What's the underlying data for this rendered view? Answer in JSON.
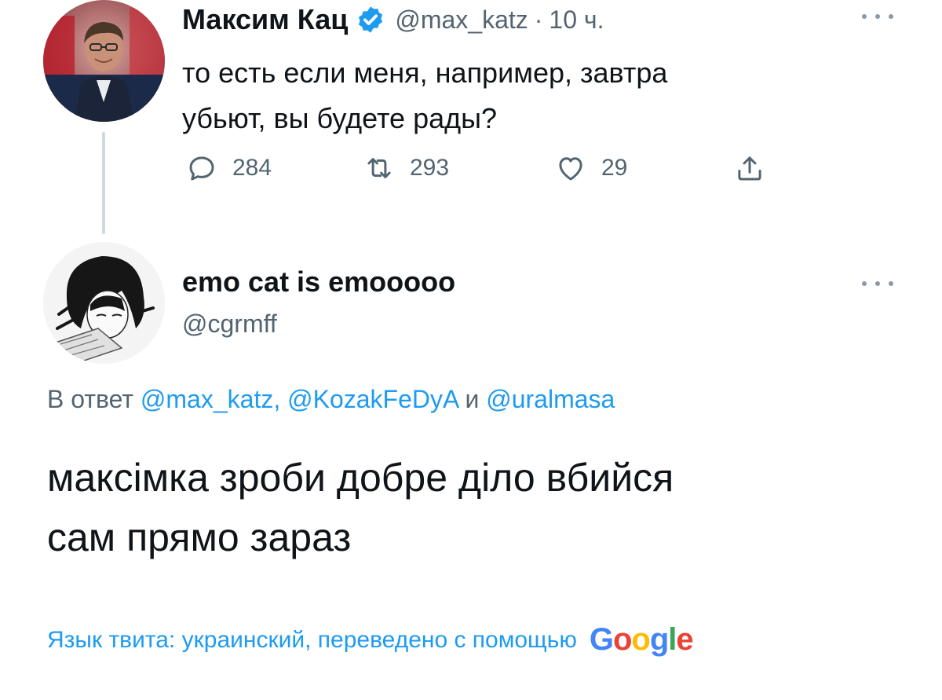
{
  "parent_tweet": {
    "author_name": "Максим Кац",
    "handle": "@max_katz",
    "separator": "·",
    "time": "10 ч.",
    "text_line1": "то есть если меня, например, завтра",
    "text_line2": "убьют, вы будете рады?",
    "stats": {
      "replies": "284",
      "retweets": "293",
      "likes": "29"
    },
    "verified": true
  },
  "reply_tweet": {
    "author_name": "emo cat is emooooo",
    "handle": "@cgrmff",
    "reply_prefix": "В ответ",
    "mentions": [
      "@max_katz,",
      "@KozakFeDyA",
      "@uralmasa"
    ],
    "reply_conjunction": "и",
    "text_line1": "максімка зроби добре діло вбийся",
    "text_line2": "сам прямо зараз",
    "translation_label": "Язык твита: украинский, переведено с помощью",
    "translation_provider": {
      "letters": [
        "G",
        "o",
        "o",
        "g",
        "l",
        "e"
      ],
      "colors": [
        "#4285F4",
        "#EA4335",
        "#FBBC05",
        "#4285F4",
        "#34A853",
        "#EA4335"
      ]
    }
  },
  "colors": {
    "accent": "#1d9bf0",
    "text_primary": "#0f1419",
    "text_secondary": "#536471",
    "thread_line": "#cfd9de"
  },
  "icons": {
    "verified": "verified-badge-icon",
    "more": "more-horizontal-icon",
    "reply": "reply-bubble-icon",
    "retweet": "retweet-icon",
    "like": "heart-icon",
    "share": "share-icon"
  }
}
